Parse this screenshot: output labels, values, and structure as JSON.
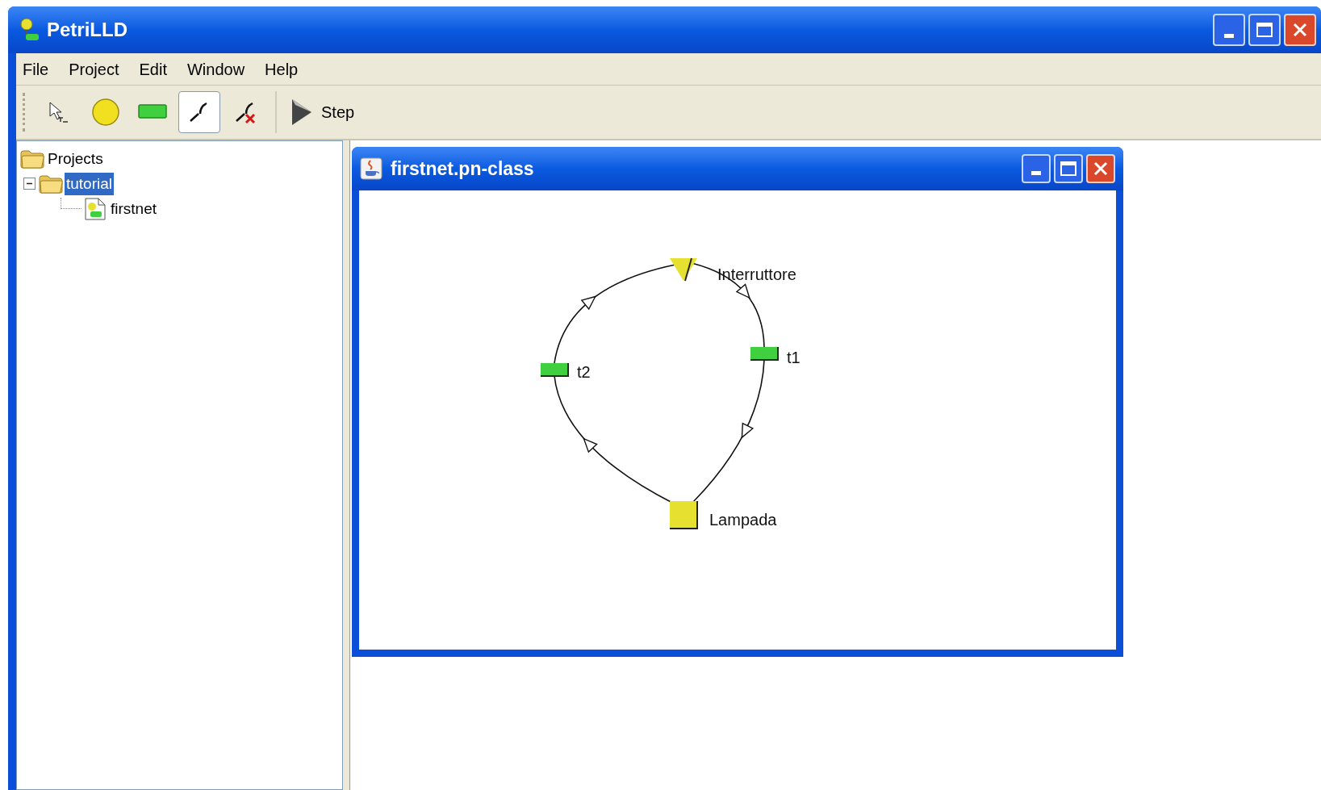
{
  "window": {
    "title": "PetriLLD"
  },
  "menu": [
    "File",
    "Project",
    "Edit",
    "Window",
    "Help"
  ],
  "toolbar": [
    {
      "kind": "select",
      "selected": false
    },
    {
      "kind": "place",
      "selected": false
    },
    {
      "kind": "transition",
      "selected": false
    },
    {
      "kind": "arc",
      "selected": true
    },
    {
      "kind": "delete-arc",
      "selected": false
    },
    {
      "kind": "step",
      "selected": false,
      "label": "Step"
    }
  ],
  "tree": {
    "label": "Projects",
    "children": [
      {
        "label": "tutorial",
        "selected": true,
        "expanded": true,
        "children": [
          {
            "label": "firstnet",
            "selected": false
          }
        ]
      }
    ]
  },
  "document": {
    "title": "firstnet.pn-class",
    "nodes": [
      {
        "kind": "input",
        "label": "Interruttore"
      },
      {
        "kind": "transition",
        "label": "t1"
      },
      {
        "kind": "output",
        "label": "Lampada"
      },
      {
        "kind": "transition",
        "label": "t2"
      }
    ]
  }
}
